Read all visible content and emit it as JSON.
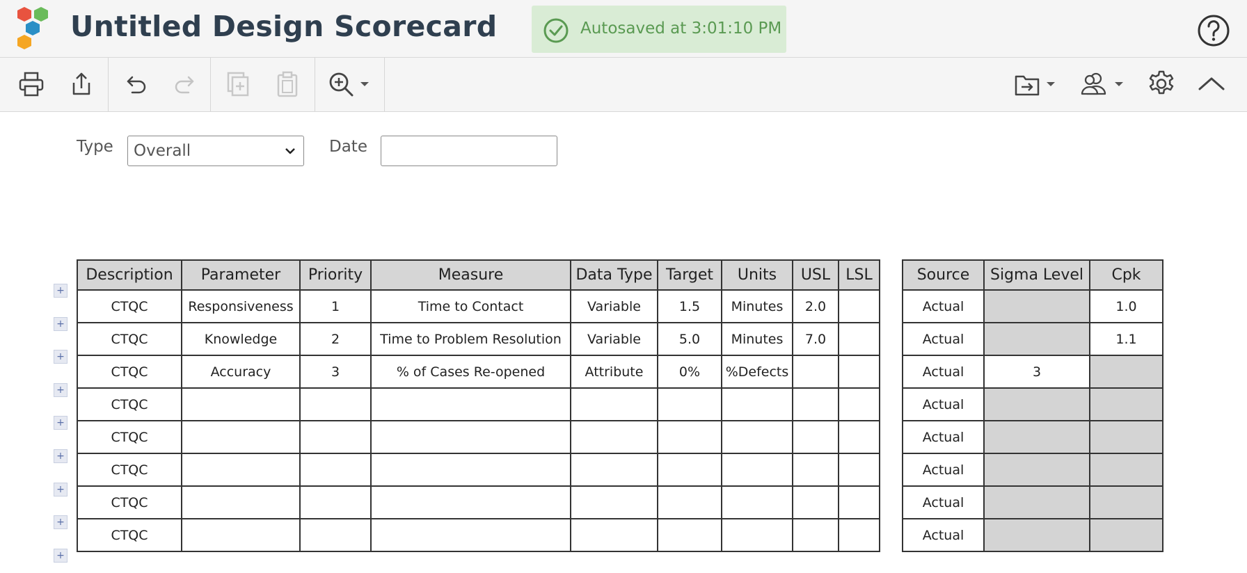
{
  "app": {
    "title": "Untitled Design Scorecard",
    "autosave_text": "Autosaved at 3:01:10 PM",
    "colors": {
      "title": "#2f3f4f",
      "autosave_bg": "#d9ecd5",
      "autosave_text": "#5a9a52",
      "logo": [
        "#e8533f",
        "#6abb5a",
        "#2a8fc6",
        "#f5a623"
      ]
    }
  },
  "toolbar": {
    "icons": [
      "print-icon",
      "share-icon",
      "undo-icon",
      "redo-icon",
      "duplicate-icon",
      "paste-icon",
      "zoom-in-icon",
      "export-icon",
      "users-icon",
      "settings-icon",
      "collapse-icon"
    ]
  },
  "filters": {
    "type_label": "Type",
    "type_value": "Overall",
    "date_label": "Date",
    "date_value": ""
  },
  "main_table": {
    "headers": [
      "Description",
      "Parameter",
      "Priority",
      "Measure",
      "Data Type",
      "Target",
      "Units",
      "USL",
      "LSL"
    ],
    "rows": [
      [
        "CTQC",
        "Responsiveness",
        "1",
        "Time to Contact",
        "Variable",
        "1.5",
        "Minutes",
        "2.0",
        ""
      ],
      [
        "CTQC",
        "Knowledge",
        "2",
        "Time to Problem Resolution",
        "Variable",
        "5.0",
        "Minutes",
        "7.0",
        ""
      ],
      [
        "CTQC",
        "Accuracy",
        "3",
        "% of Cases Re-opened",
        "Attribute",
        "0%",
        "%Defects",
        "",
        ""
      ],
      [
        "CTQC",
        "",
        "",
        "",
        "",
        "",
        "",
        "",
        ""
      ],
      [
        "CTQC",
        "",
        "",
        "",
        "",
        "",
        "",
        "",
        ""
      ],
      [
        "CTQC",
        "",
        "",
        "",
        "",
        "",
        "",
        "",
        ""
      ],
      [
        "CTQC",
        "",
        "",
        "",
        "",
        "",
        "",
        "",
        ""
      ],
      [
        "CTQC",
        "",
        "",
        "",
        "",
        "",
        "",
        "",
        ""
      ]
    ]
  },
  "side_table": {
    "headers": [
      "Source",
      "Sigma Level",
      "Cpk"
    ],
    "rows": [
      [
        "Actual",
        "",
        "1.0"
      ],
      [
        "Actual",
        "",
        "1.1"
      ],
      [
        "Actual",
        "3",
        ""
      ],
      [
        "Actual",
        "",
        ""
      ],
      [
        "Actual",
        "",
        ""
      ],
      [
        "Actual",
        "",
        ""
      ],
      [
        "Actual",
        "",
        ""
      ],
      [
        "Actual",
        "",
        ""
      ]
    ],
    "shaded": [
      [
        false,
        true,
        false
      ],
      [
        false,
        true,
        false
      ],
      [
        false,
        false,
        true
      ],
      [
        false,
        true,
        true
      ],
      [
        false,
        true,
        true
      ],
      [
        false,
        true,
        true
      ],
      [
        false,
        true,
        true
      ],
      [
        false,
        true,
        true
      ]
    ]
  },
  "add_row_label": "+"
}
